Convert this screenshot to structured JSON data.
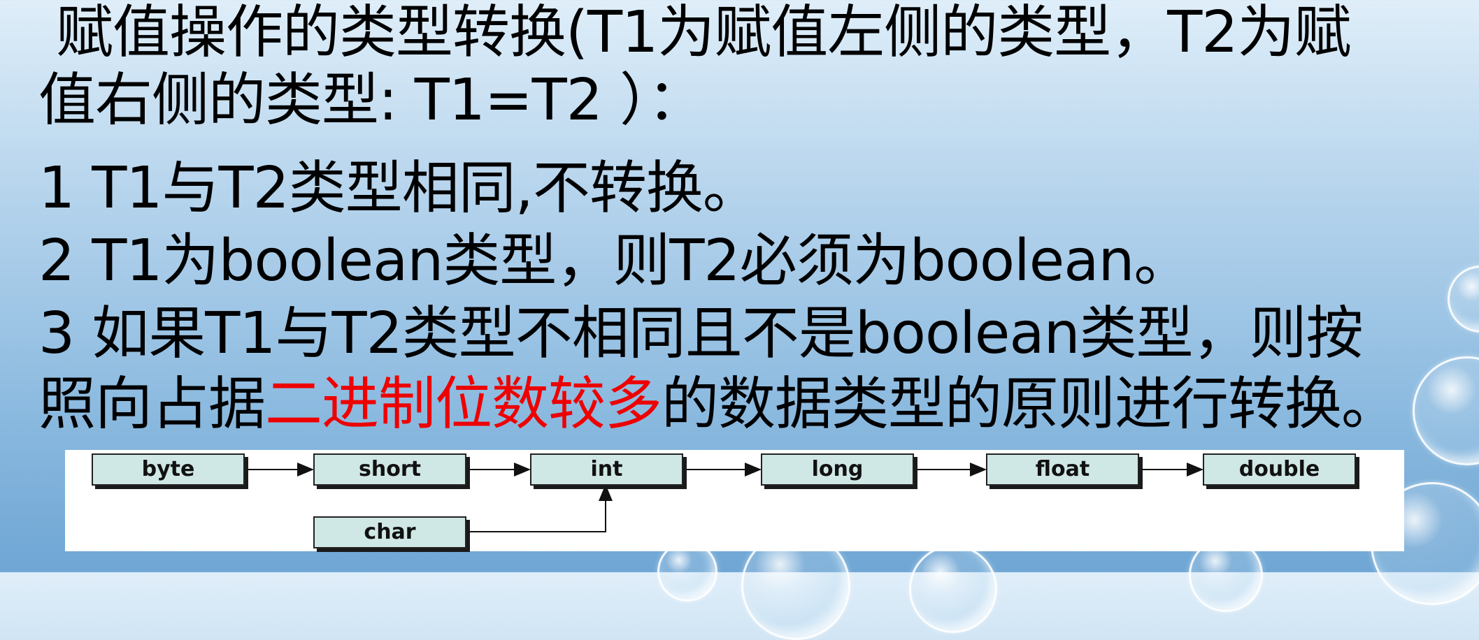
{
  "heading": {
    "line1": "赋值操作的类型转换(T1为赋值左侧的类型，T2为赋",
    "line2": "值右侧的类型:     T1=T2 ）："
  },
  "rules": [
    {
      "text": "1  T1与T2类型相同,不转换。"
    },
    {
      "text": "2  T1为boolean类型，则T2必须为boolean。"
    },
    {
      "text_a": "3  如果T1与T2类型不相同且不是boolean类型，则按",
      "text_b_before": "照向占据",
      "text_b_highlight": "二进制位数较多",
      "text_b_after": "的数据类型的原则进行转换。"
    }
  ],
  "highlight_color": "#ee0000",
  "diagram": {
    "boxes": [
      "byte",
      "short",
      "int",
      "long",
      "float",
      "double",
      "char"
    ]
  }
}
